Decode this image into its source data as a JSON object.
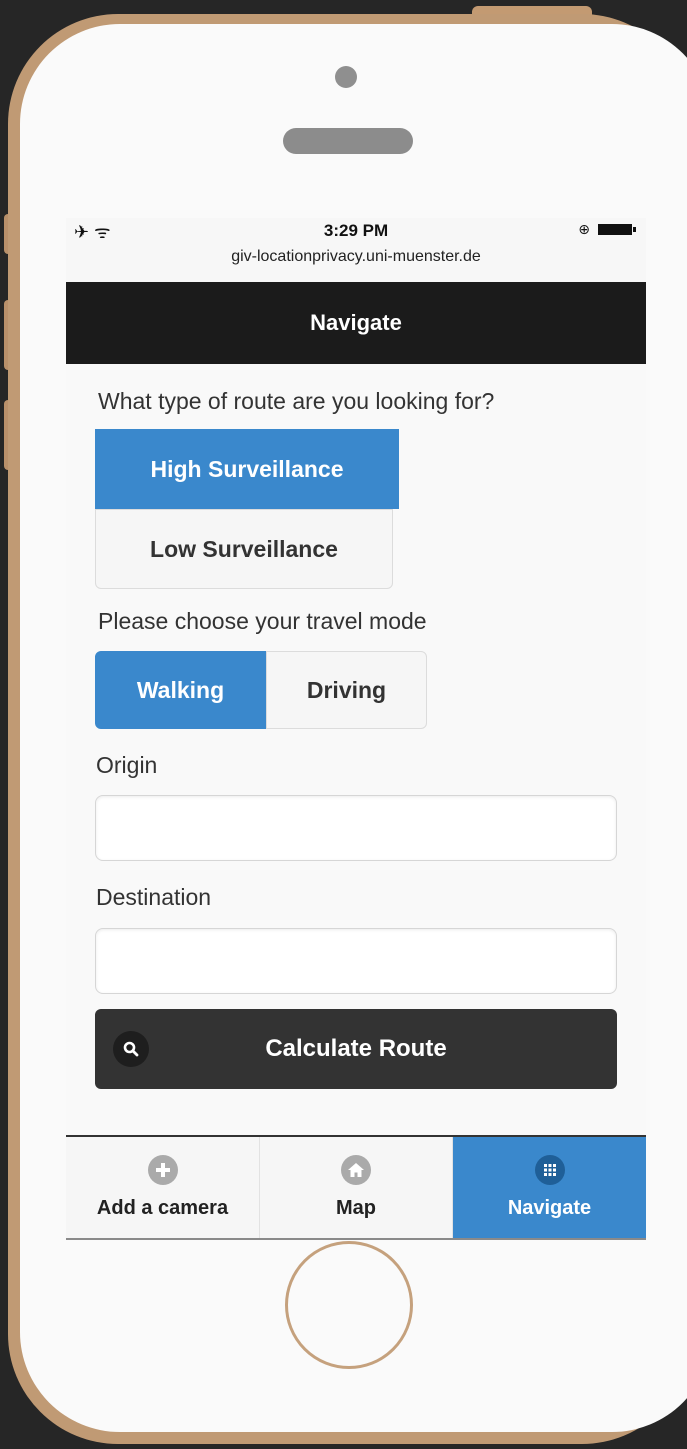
{
  "status_bar": {
    "left_icons": "✈ ᯤ",
    "time": "3:29 PM",
    "url": "giv-locationprivacy.uni-muenster.de"
  },
  "header": {
    "title": "Navigate"
  },
  "route_type": {
    "question": "What type of route are you looking for?",
    "options": [
      {
        "label": "High Surveillance",
        "selected": true
      },
      {
        "label": "Low Surveillance",
        "selected": false
      }
    ]
  },
  "travel_mode": {
    "question": "Please choose your travel mode",
    "options": [
      {
        "label": "Walking",
        "selected": true
      },
      {
        "label": "Driving",
        "selected": false
      }
    ]
  },
  "origin": {
    "label": "Origin",
    "value": ""
  },
  "destination": {
    "label": "Destination",
    "value": ""
  },
  "calculate": {
    "label": "Calculate Route",
    "icon": "search-icon"
  },
  "tabbar": {
    "tabs": [
      {
        "label": "Add a camera",
        "icon": "plus-circle-icon",
        "active": false
      },
      {
        "label": "Map",
        "icon": "home-icon",
        "active": false
      },
      {
        "label": "Navigate",
        "icon": "grid-icon",
        "active": true
      }
    ]
  },
  "colors": {
    "accent": "#3a88cc",
    "header_bg": "#1b1b1b",
    "phone_gold": "#c09a74"
  }
}
